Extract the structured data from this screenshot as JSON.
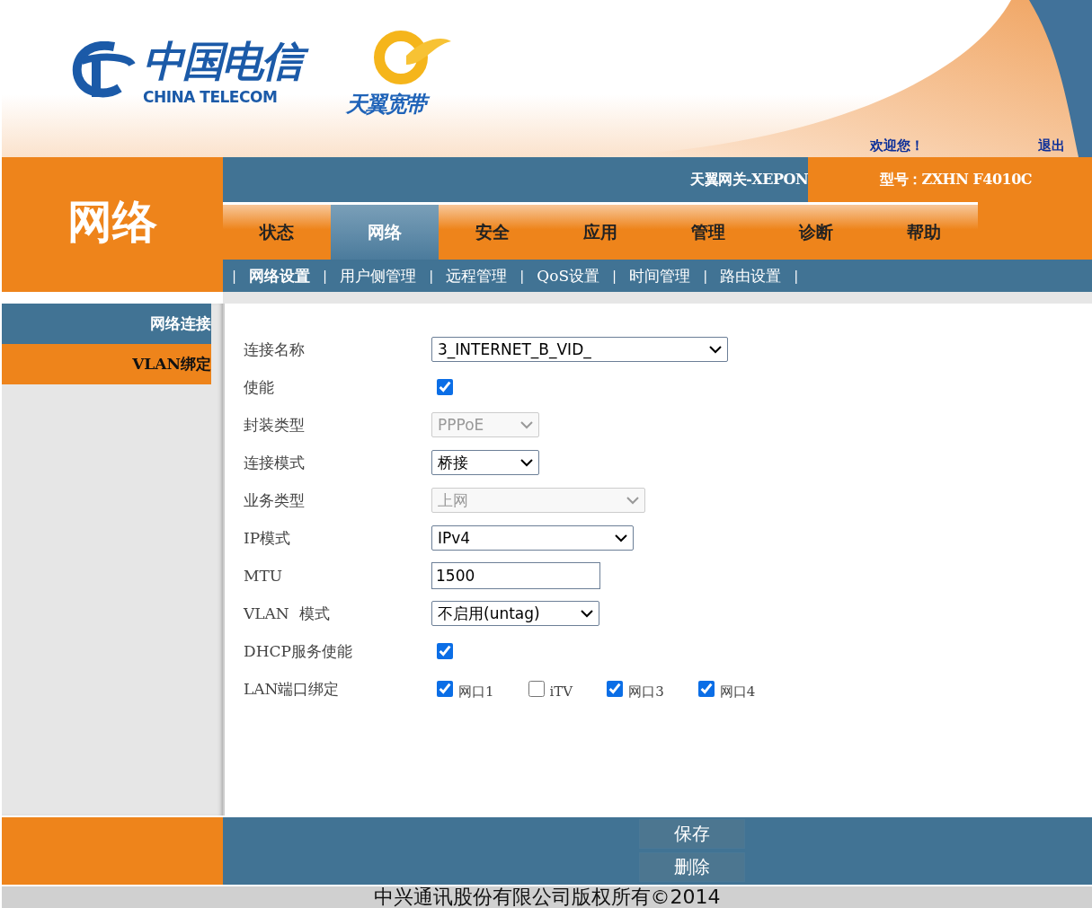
{
  "header": {
    "logo_cn": "中国电信",
    "logo_en": "CHINA TELECOM",
    "brand": "天翼宽带",
    "welcome": "欢迎您！",
    "logout": "退出"
  },
  "section_title": "网络",
  "gateway_name": "天翼网关-XEPON",
  "model": "型号：ZXHN F4010C",
  "tabs": [
    {
      "label": "状态",
      "selected": false
    },
    {
      "label": "网络",
      "selected": true
    },
    {
      "label": "安全",
      "selected": false
    },
    {
      "label": "应用",
      "selected": false
    },
    {
      "label": "管理",
      "selected": false
    },
    {
      "label": "诊断",
      "selected": false
    },
    {
      "label": "帮助",
      "selected": false
    }
  ],
  "subnav_separator": "|",
  "subnav": [
    {
      "label": "网络设置",
      "selected": true
    },
    {
      "label": "用户侧管理",
      "selected": false
    },
    {
      "label": "远程管理",
      "selected": false
    },
    {
      "label": "QoS设置",
      "selected": false
    },
    {
      "label": "时间管理",
      "selected": false
    },
    {
      "label": "路由设置",
      "selected": false
    }
  ],
  "sidebar": [
    {
      "label": "网络连接",
      "selected": true
    },
    {
      "label": "VLAN绑定",
      "selected": false
    }
  ],
  "form": [
    {
      "kind": "select",
      "label": "连接名称",
      "value": "3_INTERNET_B_VID_",
      "disabled": false
    },
    {
      "kind": "checkbox",
      "label": "使能",
      "checked": true
    },
    {
      "kind": "select",
      "label": "封装类型",
      "value": "PPPoE",
      "disabled": true
    },
    {
      "kind": "select",
      "label": "连接模式",
      "value": "桥接",
      "disabled": false
    },
    {
      "kind": "select",
      "label": "业务类型",
      "value": "上网",
      "disabled": true
    },
    {
      "kind": "select",
      "label": "IP模式",
      "value": "IPv4",
      "disabled": false
    },
    {
      "kind": "input",
      "label": "MTU",
      "value": "1500"
    },
    {
      "kind": "select",
      "label": "VLAN  模式",
      "value": "不启用(untag)",
      "disabled": false
    },
    {
      "kind": "checkbox",
      "label": "DHCP服务使能",
      "checked": true
    },
    {
      "kind": "checkgroup",
      "label": "LAN端口绑定",
      "options": [
        {
          "label": "网口1",
          "checked": true
        },
        {
          "label": "iTV",
          "checked": false
        },
        {
          "label": "网口3",
          "checked": true
        },
        {
          "label": "网口4",
          "checked": true
        }
      ]
    }
  ],
  "buttons": [
    "保存",
    "删除"
  ],
  "copyright": "中兴通讯股份有限公司版权所有©2014"
}
